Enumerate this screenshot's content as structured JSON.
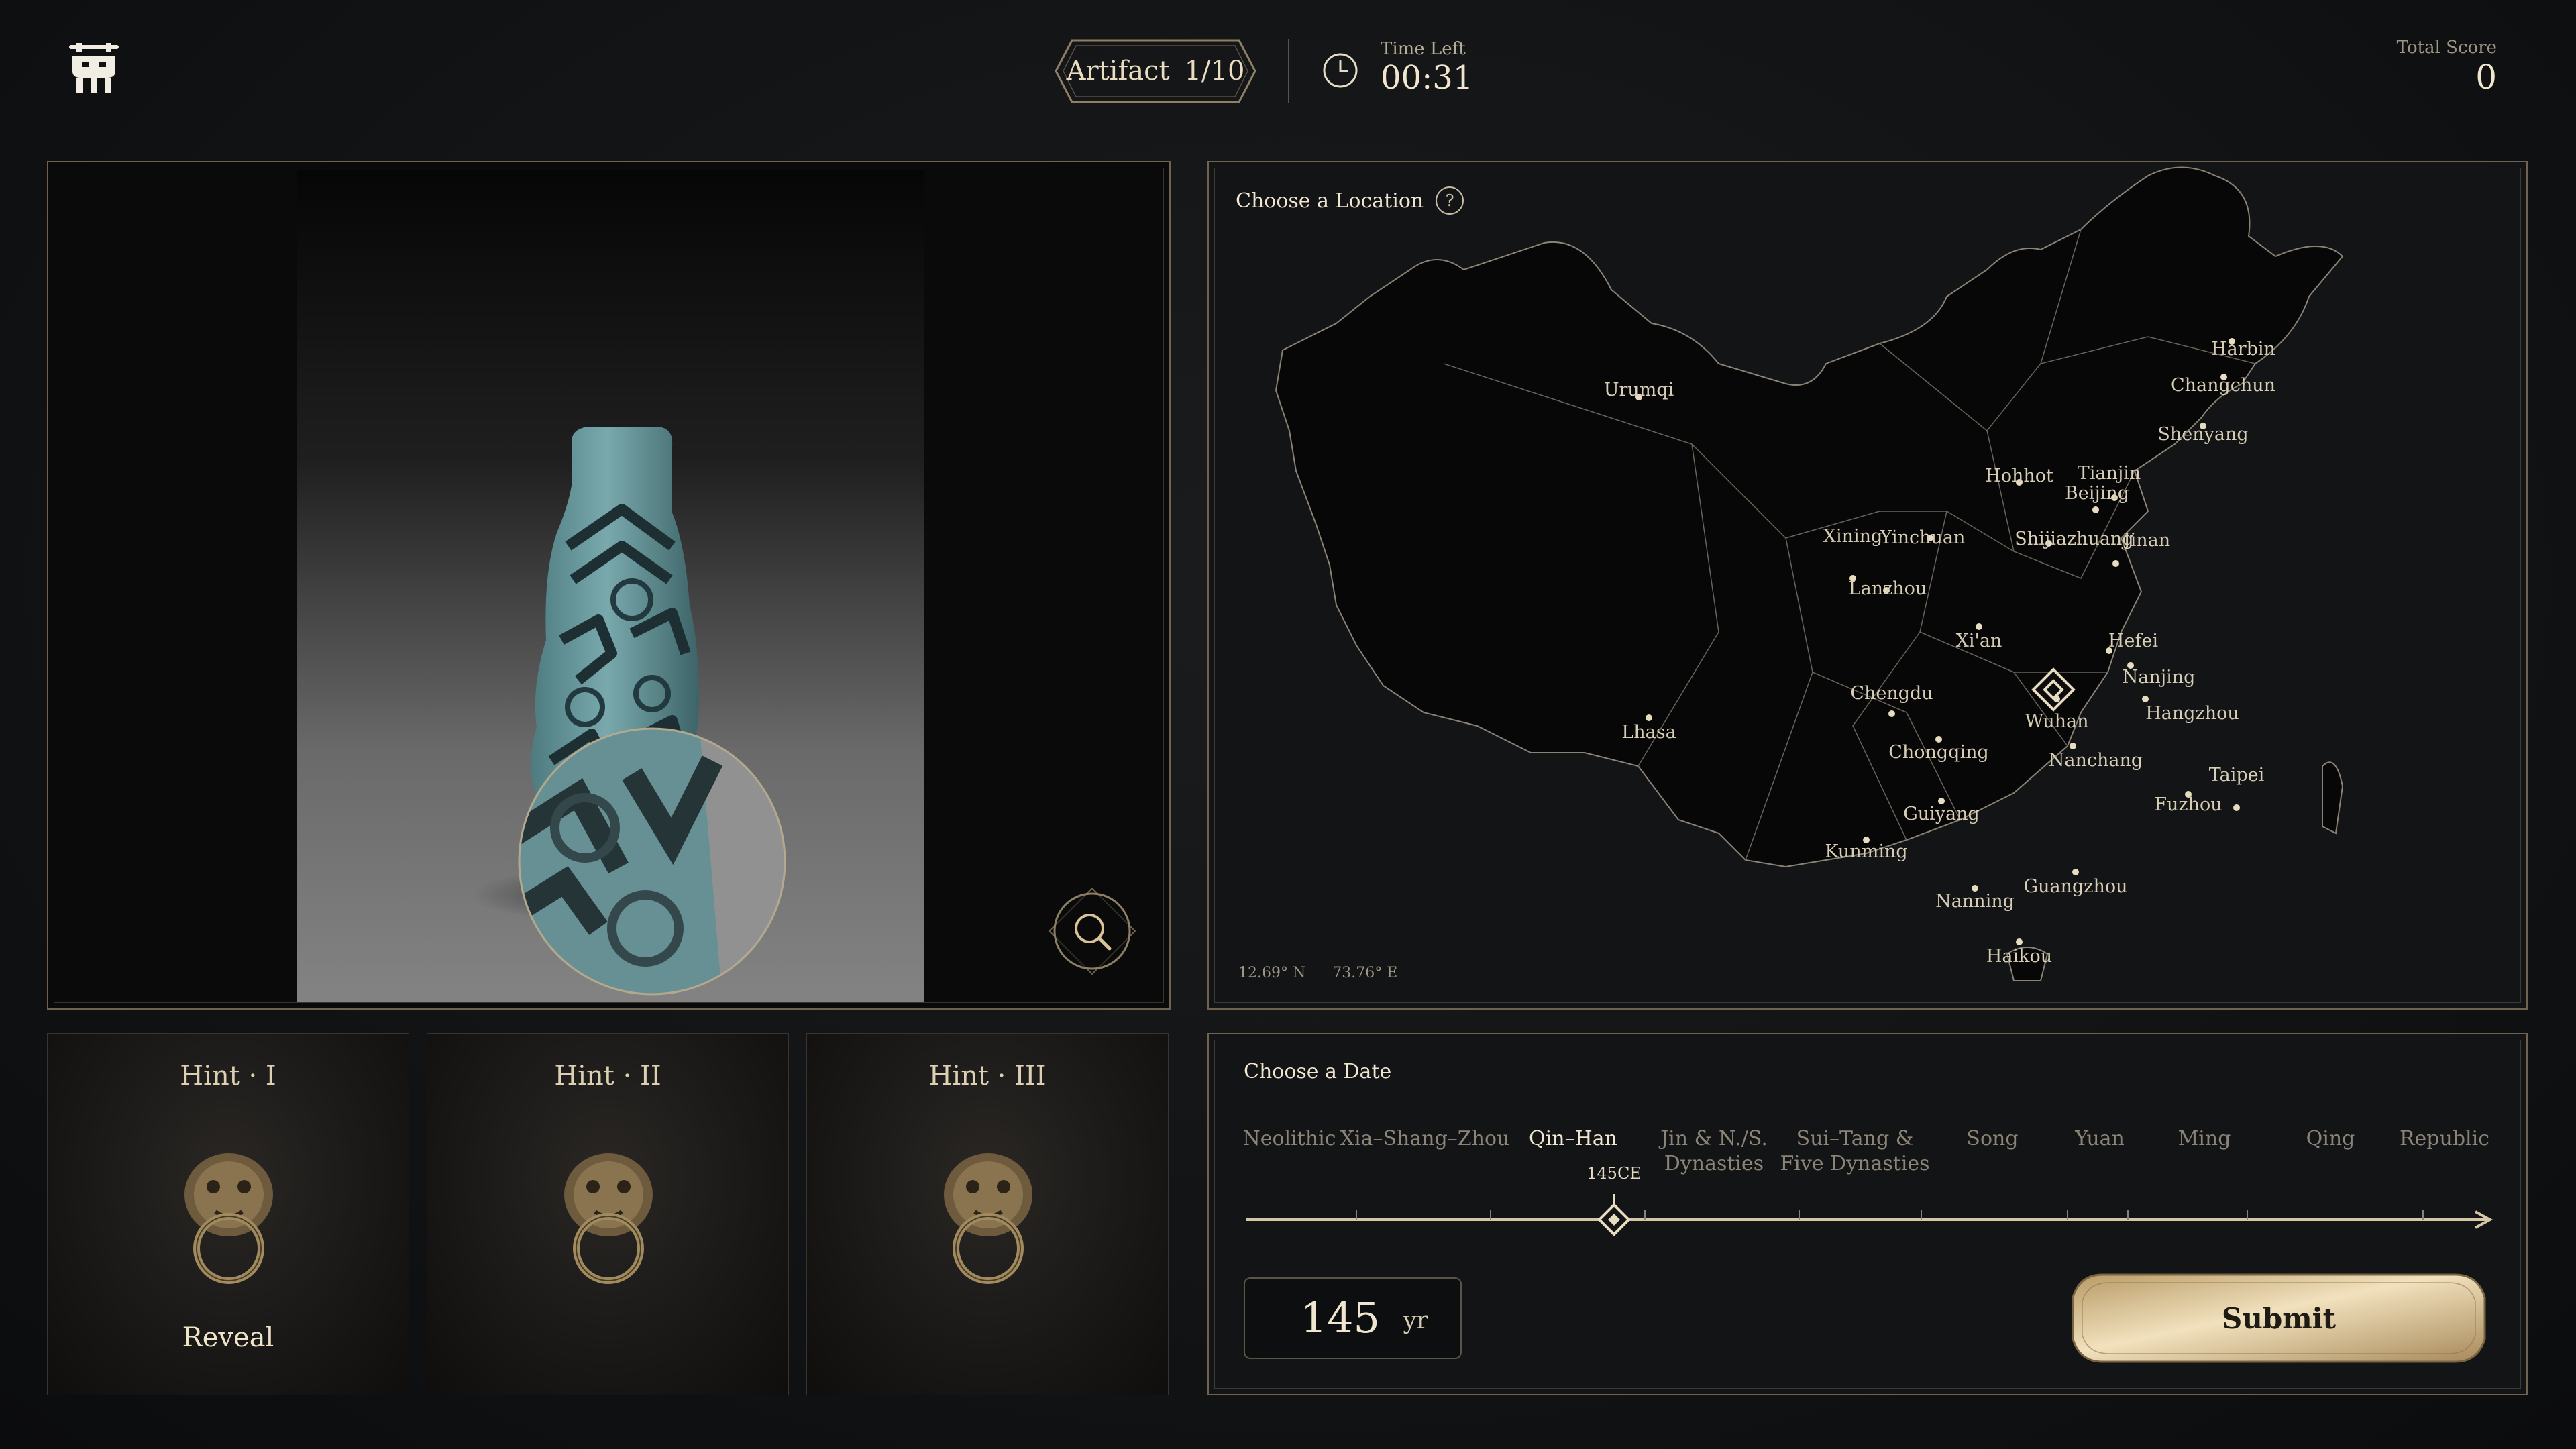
{
  "header": {
    "logo_icon": "bronze-ding-icon",
    "artifact_label": "Artifact",
    "artifact_progress": "1/10",
    "time_label": "Time Left",
    "time_value": "00:31",
    "score_label": "Total Score",
    "score_value": "0"
  },
  "artifact": {
    "zoom_icon": "magnifier-icon"
  },
  "map": {
    "title": "Choose a Location",
    "help_label": "?",
    "coords_lat": "12.69° N",
    "coords_lon": "73.76° E",
    "cities": [
      "Harbin",
      "Changchun",
      "Shenyang",
      "Urumqi",
      "Hohhot",
      "Tianjin",
      "Beijing",
      "Xining",
      "Yinchuan",
      "Shijiazhuang",
      "Jinan",
      "Lanzhou",
      "Xi'an",
      "Hefei",
      "Nanjing",
      "Chengdu",
      "Wuhan",
      "Hangzhou",
      "Lhasa",
      "Chongqing",
      "Nanchang",
      "Taipei",
      "Fuzhou",
      "Guiyang",
      "Kunming",
      "Guangzhou",
      "Nanning",
      "Haikou"
    ]
  },
  "hints": [
    {
      "title": "Hint · I",
      "action": "Reveal"
    },
    {
      "title": "Hint · II",
      "action": ""
    },
    {
      "title": "Hint · III",
      "action": ""
    }
  ],
  "date": {
    "title": "Choose a Date",
    "eras": [
      {
        "label": "Neolithic",
        "active": false
      },
      {
        "label": "Xia–Shang–Zhou",
        "active": false
      },
      {
        "label": "Qin–Han",
        "active": true
      },
      {
        "label": "Jin & N./S.\nDynasties",
        "active": false
      },
      {
        "label": "Sui–Tang &\nFive Dynasties",
        "active": false
      },
      {
        "label": "Song",
        "active": false
      },
      {
        "label": "Yuan",
        "active": false
      },
      {
        "label": "Ming",
        "active": false
      },
      {
        "label": "Qing",
        "active": false
      },
      {
        "label": "Republic",
        "active": false
      }
    ],
    "marker_label": "145CE",
    "year_value": "145",
    "year_unit": "yr",
    "submit_label": "Submit"
  },
  "colors": {
    "accent_gold": "#d9c39a",
    "text_primary": "#f0e6d0",
    "text_muted": "#8b8477",
    "panel_bg": "#131416"
  }
}
